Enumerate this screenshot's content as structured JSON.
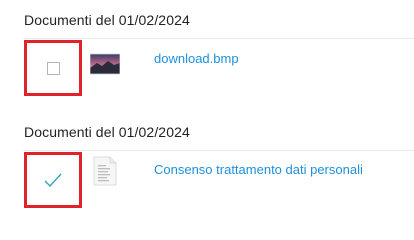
{
  "groups": [
    {
      "heading": "Documenti del 01/02/2024",
      "item": {
        "name": "download.bmp",
        "checked": false,
        "icon": "image-thumbnail-icon"
      }
    },
    {
      "heading": "Documenti del 01/02/2024",
      "item": {
        "name": "Consenso trattamento dati personali",
        "checked": true,
        "icon": "document-icon"
      }
    }
  ],
  "colors": {
    "highlight": "#e0222a",
    "link": "#1e90dd",
    "check": "#2aa6b8"
  }
}
